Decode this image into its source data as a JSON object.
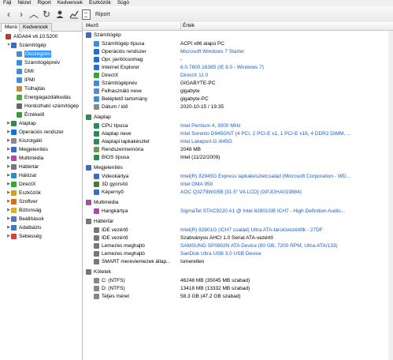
{
  "menubar": [
    "Fájl",
    "Nézet",
    "Riport",
    "Kedvencek",
    "Eszközök",
    "Súgó"
  ],
  "toolbar": {
    "report_label": "Riport"
  },
  "left": {
    "tabs": [
      "Menü",
      "Kedvencek"
    ],
    "tree": [
      {
        "label": "AIDA64 v6.10.5200",
        "icon_color": "#c0392b",
        "indent": 0,
        "exp": "",
        "sel": false
      },
      {
        "label": "Számítógép",
        "icon_color": "#3b6cc4",
        "indent": 1,
        "exp": "▼",
        "sel": false
      },
      {
        "label": "Összegzés",
        "icon_color": "#3b8fd4",
        "indent": 2,
        "exp": "",
        "sel": true
      },
      {
        "label": "Számítógépnév",
        "icon_color": "#3b8fd4",
        "indent": 2,
        "exp": "",
        "sel": false
      },
      {
        "label": "DMI",
        "icon_color": "#3b8fd4",
        "indent": 2,
        "exp": "",
        "sel": false
      },
      {
        "label": "IPMI",
        "icon_color": "#3b8fd4",
        "indent": 2,
        "exp": "",
        "sel": false
      },
      {
        "label": "Túlhajtás",
        "icon_color": "#d08a2b",
        "indent": 2,
        "exp": "",
        "sel": false
      },
      {
        "label": "Energiagazdálkodás",
        "icon_color": "#4aa84a",
        "indent": 2,
        "exp": "",
        "sel": false
      },
      {
        "label": "Hordozható számítógép",
        "icon_color": "#666666",
        "indent": 2,
        "exp": "",
        "sel": false
      },
      {
        "label": "Érzékelő",
        "icon_color": "#3a9a3a",
        "indent": 2,
        "exp": "",
        "sel": false
      },
      {
        "label": "Alaplap",
        "icon_color": "#2e8b57",
        "indent": 1,
        "exp": "▶",
        "sel": false
      },
      {
        "label": "Operációs rendszer",
        "icon_color": "#1e6fd1",
        "indent": 1,
        "exp": "▶",
        "sel": false
      },
      {
        "label": "Kiszolgáló",
        "icon_color": "#8a8a8a",
        "indent": 1,
        "exp": "▶",
        "sel": false
      },
      {
        "label": "Megjelenítés",
        "icon_color": "#3b6cc4",
        "indent": 1,
        "exp": "▶",
        "sel": false
      },
      {
        "label": "Multimédia",
        "icon_color": "#b04aa8",
        "indent": 1,
        "exp": "▶",
        "sel": false
      },
      {
        "label": "Háttértár",
        "icon_color": "#777777",
        "indent": 1,
        "exp": "▶",
        "sel": false
      },
      {
        "label": "Hálózat",
        "icon_color": "#2d8bd0",
        "indent": 1,
        "exp": "▶",
        "sel": false
      },
      {
        "label": "DirectX",
        "icon_color": "#3aa33a",
        "indent": 1,
        "exp": "▶",
        "sel": false
      },
      {
        "label": "Eszközök",
        "icon_color": "#d0a020",
        "indent": 1,
        "exp": "▶",
        "sel": false
      },
      {
        "label": "Szoftver",
        "icon_color": "#d07020",
        "indent": 1,
        "exp": "▶",
        "sel": false
      },
      {
        "label": "Biztonság",
        "icon_color": "#e0b020",
        "indent": 1,
        "exp": "▶",
        "sel": false
      },
      {
        "label": "Beállítások",
        "icon_color": "#5577aa",
        "indent": 1,
        "exp": "▶",
        "sel": false
      },
      {
        "label": "Adatbázis",
        "icon_color": "#4477cc",
        "indent": 1,
        "exp": "▶",
        "sel": false
      },
      {
        "label": "Sebesség",
        "icon_color": "#cc4444",
        "indent": 1,
        "exp": "▶",
        "sel": false
      }
    ]
  },
  "columns": {
    "field": "Mező",
    "value": "Érték"
  },
  "rows": [
    {
      "kind": "sec",
      "field": "Számítógép",
      "value": "",
      "icon_color": "#3b6cc4"
    },
    {
      "kind": "row",
      "field": "Számítógép típusa",
      "value": "ACPI x86 alapú PC",
      "link": false,
      "icon_color": "#3b8fd4"
    },
    {
      "kind": "row",
      "field": "Operációs rendszer",
      "value": "Microsoft Windows 7 Starter",
      "link": true,
      "icon_color": "#1e6fd1"
    },
    {
      "kind": "row",
      "field": "Opr. javítócsomag",
      "value": "-",
      "link": false,
      "icon_color": "#1e6fd1"
    },
    {
      "kind": "row",
      "field": "Internet Explorer",
      "value": "8.0.7600.16385 (IE 8.0 - Windows 7)",
      "link": true,
      "icon_color": "#2a6fd8"
    },
    {
      "kind": "row",
      "field": "DirectX",
      "value": "DirectX 11.0",
      "link": true,
      "icon_color": "#3aa33a"
    },
    {
      "kind": "row",
      "field": "Számítógépnév",
      "value": "GIGABYTE-PC",
      "link": false,
      "icon_color": "#3b8fd4"
    },
    {
      "kind": "row",
      "field": "Felhasználó neve",
      "value": "gigabyte",
      "link": false,
      "icon_color": "#5a8ad0"
    },
    {
      "kind": "row",
      "field": "Beléptető tartomány",
      "value": "gigabyte-PC",
      "link": false,
      "icon_color": "#3b8fd4"
    },
    {
      "kind": "row",
      "field": "Dátum / idő",
      "value": "2020-10-15 / 19:35",
      "link": false,
      "icon_color": "#888888"
    },
    {
      "kind": "gap"
    },
    {
      "kind": "sec",
      "field": "Alaplap",
      "value": "",
      "icon_color": "#2e8b57"
    },
    {
      "kind": "row",
      "field": "CPU típusa",
      "value": "Intel Pentium 4, 3000 MHz",
      "link": true,
      "icon_color": "#2e8b57"
    },
    {
      "kind": "row",
      "field": "Alaplap neve",
      "value": "Intel Sorento D945GNT (4 PCI, 2 PCI-E x1, 1 PCI-E x16, 4 DDR2 DIMM, ...",
      "link": true,
      "icon_color": "#2e8b57"
    },
    {
      "kind": "row",
      "field": "Alaplapi lapkakészlet",
      "value": "Intel Lakeport-G i945G",
      "link": true,
      "icon_color": "#2e8b57"
    },
    {
      "kind": "row",
      "field": "Rendszermemória",
      "value": "2048 MB",
      "link": false,
      "icon_color": "#6a9a4a"
    },
    {
      "kind": "row",
      "field": "BIOS típusa",
      "value": "Intel (11/22/2009)",
      "link": false,
      "icon_color": "#2e8b57"
    },
    {
      "kind": "gap"
    },
    {
      "kind": "sec",
      "field": "Megjelenítés",
      "value": "",
      "icon_color": "#3b6cc4"
    },
    {
      "kind": "row",
      "field": "Videokártya",
      "value": "Intel(R) 82945G Express lapkakészletcsalád (Microsoft Corporation - WD...",
      "link": true,
      "icon_color": "#3b6cc4"
    },
    {
      "kind": "row",
      "field": "3D gyorsító",
      "value": "Intel GMA 950",
      "link": true,
      "icon_color": "#4a7a2a"
    },
    {
      "kind": "row",
      "field": "Képernyő",
      "value": "AOC Q3279WG5B [31.5\" VA LCD] (GPJGHA019884)",
      "link": true,
      "icon_color": "#3b6cc4"
    },
    {
      "kind": "gap"
    },
    {
      "kind": "sec",
      "field": "Multimédia",
      "value": "",
      "icon_color": "#b04aa8"
    },
    {
      "kind": "row",
      "field": "Hangkártya",
      "value": "SigmaTel STAC9220 A1 @ Intel 82801GB ICH7 - High Definition Audio...",
      "link": true,
      "icon_color": "#b04aa8"
    },
    {
      "kind": "gap"
    },
    {
      "kind": "sec",
      "field": "Háttértár",
      "value": "",
      "icon_color": "#777777"
    },
    {
      "kind": "row",
      "field": "IDE vezérlő",
      "value": "Intel(R) 82801G (ICH7 család) Ultra ATA-tárolóvezérlők - 27DF",
      "link": true,
      "icon_color": "#777777"
    },
    {
      "kind": "row",
      "field": "IDE vezérlő",
      "value": "Szabványos AHCI 1.0 Serial ATA-vezérlő",
      "link": false,
      "icon_color": "#777777"
    },
    {
      "kind": "row",
      "field": "Lemezes meghajtó",
      "value": "SAMSUNG SP0802N ATA Device (80 GB, 7200 RPM, Ultra-ATA/133)",
      "link": true,
      "icon_color": "#777777"
    },
    {
      "kind": "row",
      "field": "Lemezes meghajtó",
      "value": "SanDisk Ultra USB 3.0 USB Device",
      "link": true,
      "icon_color": "#777777"
    },
    {
      "kind": "row",
      "field": "SMART merevlemezek állap...",
      "value": "Ismeretlen",
      "link": false,
      "icon_color": "#777777"
    },
    {
      "kind": "gap"
    },
    {
      "kind": "sec",
      "field": "Kötetek",
      "value": "",
      "icon_color": "#777777"
    },
    {
      "kind": "row",
      "field": "C: (NTFS)",
      "value": "46248 MB (35045 MB szabad)",
      "link": false,
      "icon_color": "#888888"
    },
    {
      "kind": "row",
      "field": "D: (NTFS)",
      "value": "13418 MB (13332 MB szabad)",
      "link": false,
      "icon_color": "#888888"
    },
    {
      "kind": "row",
      "field": "Teljes méret",
      "value": "58.3 GB (47.2 GB szabad)",
      "link": false,
      "icon_color": "#888888"
    }
  ]
}
